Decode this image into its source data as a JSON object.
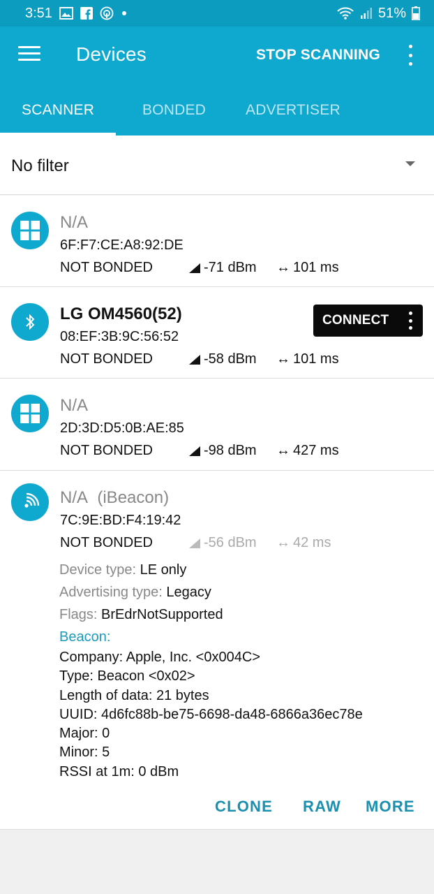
{
  "status_bar": {
    "time": "3:51",
    "battery": "51%",
    "icons": [
      "gallery-icon",
      "facebook-icon",
      "hotspot-icon",
      "dot-icon",
      "wifi-icon",
      "signal-icon",
      "battery-icon"
    ]
  },
  "app_bar": {
    "title": "Devices",
    "stop_scanning": "STOP SCANNING"
  },
  "tabs": [
    {
      "label": "SCANNER",
      "active": true
    },
    {
      "label": "BONDED",
      "active": false
    },
    {
      "label": "ADVERTISER",
      "active": false
    }
  ],
  "filter": {
    "label": "No filter"
  },
  "devices": [
    {
      "name": "N/A",
      "mac": "6F:F7:CE:A8:92:DE",
      "bond": "NOT BONDED",
      "rssi": "-71 dBm",
      "interval": "101 ms",
      "icon": "windows-icon"
    },
    {
      "name": "LG OM4560(52)",
      "mac": "08:EF:3B:9C:56:52",
      "bond": "NOT BONDED",
      "rssi": "-58 dBm",
      "interval": "101 ms",
      "icon": "bluetooth-icon",
      "connect_label": "CONNECT"
    },
    {
      "name": "N/A",
      "mac": "2D:3D:D5:0B:AE:85",
      "bond": "NOT BONDED",
      "rssi": "-98 dBm",
      "interval": "427 ms",
      "icon": "windows-icon"
    },
    {
      "name": "N/A",
      "name_suffix": "(iBeacon)",
      "mac": "7C:9E:BD:F4:19:42",
      "bond": "NOT BONDED",
      "rssi": "-56 dBm",
      "interval": "42 ms",
      "icon": "beacon-icon",
      "details": {
        "device_type_label": "Device type: ",
        "device_type": "LE only",
        "advertising_type_label": "Advertising type: ",
        "advertising_type": "Legacy",
        "flags_label": "Flags: ",
        "flags": "BrEdrNotSupported",
        "beacon_header": "Beacon:",
        "company": "Company: Apple, Inc. <0x004C>",
        "type": "Type: Beacon <0x02>",
        "length": "Length of data: 21 bytes",
        "uuid": "UUID: 4d6fc88b-be75-6698-da48-6866a36ec78e",
        "major": "Major: 0",
        "minor": "Minor: 5",
        "rssi_1m": "RSSI at 1m: 0 dBm"
      },
      "actions": {
        "clone": "CLONE",
        "raw": "RAW",
        "more": "MORE"
      }
    }
  ],
  "colors": {
    "primary": "#0fa8cf",
    "status_bar": "#0c9cc0",
    "accent_text": "#1a8fb0"
  }
}
